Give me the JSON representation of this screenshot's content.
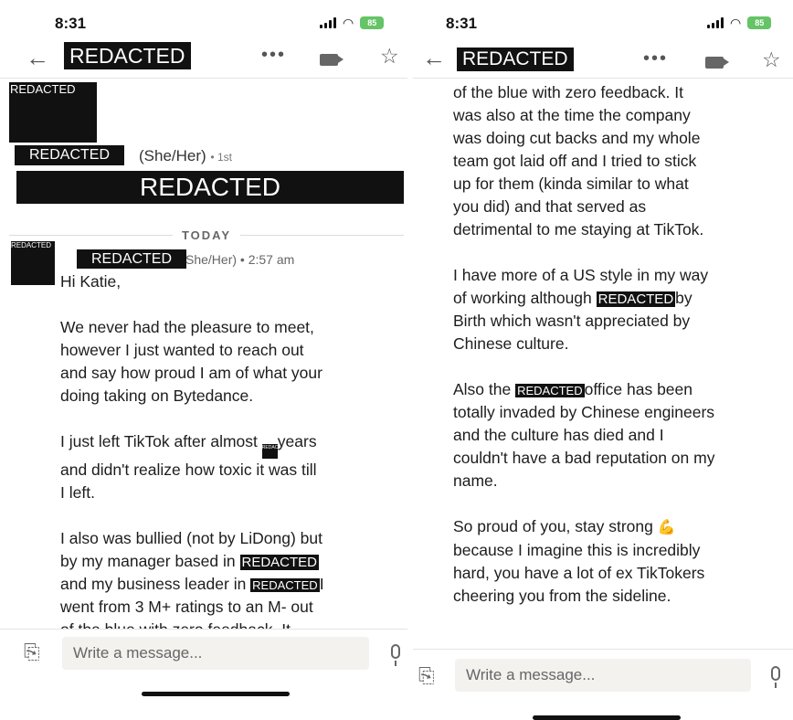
{
  "status": {
    "time": "8:31",
    "battery": "85"
  },
  "left_panel": {
    "header_title": "REDACTED",
    "profile_photo_label": "REDACTED",
    "profile_name": "REDACTED",
    "profile_pronouns": "(She/Her)",
    "profile_degree": "• 1st",
    "profile_headline": "REDACTED",
    "day_divider": "TODAY",
    "avatar_label": "REDACTED",
    "sender_name": "REDACTED",
    "sender_meta": "She/Her)  •  2:57 am",
    "msg": {
      "greeting": "Hi Katie,",
      "p1": [
        "We never had the pleasure to meet,",
        "however I just wanted to reach out",
        "and say how proud I am of what your",
        "doing taking on Bytedance."
      ],
      "p2_l1a": "I just left TikTok after almost ",
      "p2_l1_red": "REDACTED",
      "p2_l1b": "years",
      "p2_rest": [
        "and didn't realize how toxic it was till",
        "I left."
      ],
      "p3_l1": "I also was bullied (not by LiDong) but",
      "p3_l2a": "by my manager based in ",
      "p3_l2_red": "REDACTED",
      "p3_l3a": "and my business leader in ",
      "p3_l3_red": "REDACTED",
      "p3_l3b": "I",
      "p3_l4": "went from 3 M+ ratings to an M- out",
      "p3_l5": "of the blue with zero feedback. It"
    },
    "input_placeholder": "Write a message..."
  },
  "right_panel": {
    "header_title": "REDACTED",
    "p1": [
      "of the blue with zero feedback. It",
      "was also at the time the company",
      "was doing cut backs and my whole",
      "team got laid off and I tried to stick",
      "up for them (kinda similar to what",
      "you did) and that served as",
      "detrimental to me staying at TikTok."
    ],
    "p2_l1": "I have more of a US style in my way",
    "p2_l2a": "of working although ",
    "p2_l2_red": "REDACTED",
    "p2_l2b": "by",
    "p2_rest": [
      "Birth which wasn't appreciated by",
      "Chinese culture."
    ],
    "p3_l1a": "Also the ",
    "p3_l1_red": "REDACTED",
    "p3_l1b": "office has been",
    "p3_rest": [
      "totally invaded by Chinese engineers",
      "and the culture has died and I",
      "couldn't have a bad reputation on my",
      "name."
    ],
    "p4_l1": "So proud of you, stay strong ",
    "p4_rest": [
      "because I imagine this is incredibly",
      "hard, you have a lot of ex TikTokers",
      "cheering you from the sideline."
    ],
    "input_placeholder": "Write a message..."
  }
}
